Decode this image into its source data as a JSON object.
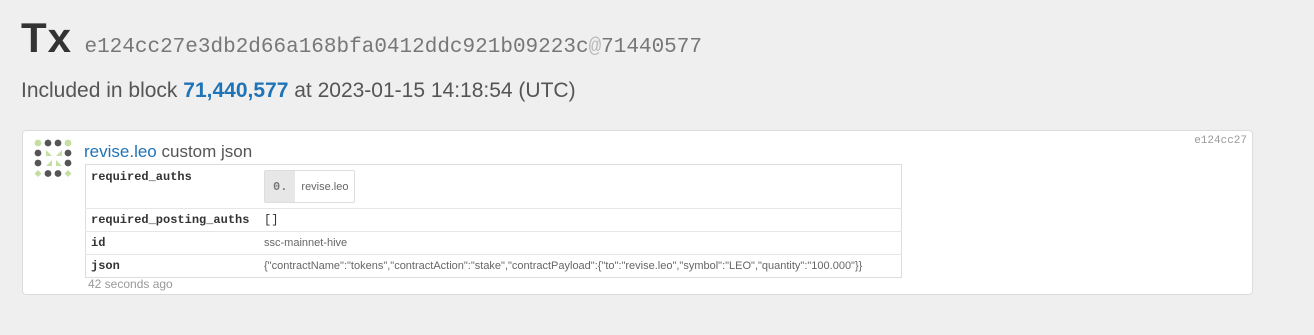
{
  "tx": {
    "label": "Tx",
    "hash": "e124cc27e3db2d66a168bfa0412ddc921b09223c",
    "at_symbol": "@",
    "block_suffix": "71440577"
  },
  "block_info": {
    "prefix": "Included in block",
    "block_number": "71,440,577",
    "at_text": "at 2023-01-15 14:18:54 (UTC)"
  },
  "operation": {
    "short_id": "e124cc27",
    "account": "revise.leo",
    "type_label": "custom json",
    "params": {
      "required_auths_key": "required_auths",
      "required_auths_index": "0.",
      "required_auths_value": "revise.leo",
      "required_posting_auths_key": "required_posting_auths",
      "required_posting_auths_value": "[]",
      "id_key": "id",
      "id_value": "ssc-mainnet-hive",
      "json_key": "json",
      "json_value": "{\"contractName\":\"tokens\",\"contractAction\":\"stake\",\"contractPayload\":{\"to\":\"revise.leo\",\"symbol\":\"LEO\",\"quantity\":\"100.000\"}}"
    },
    "time_ago": "42 seconds ago"
  },
  "colors": {
    "link": "#1f73b7",
    "avatar_dark": "#555555",
    "avatar_light": "#c5dfa3"
  }
}
